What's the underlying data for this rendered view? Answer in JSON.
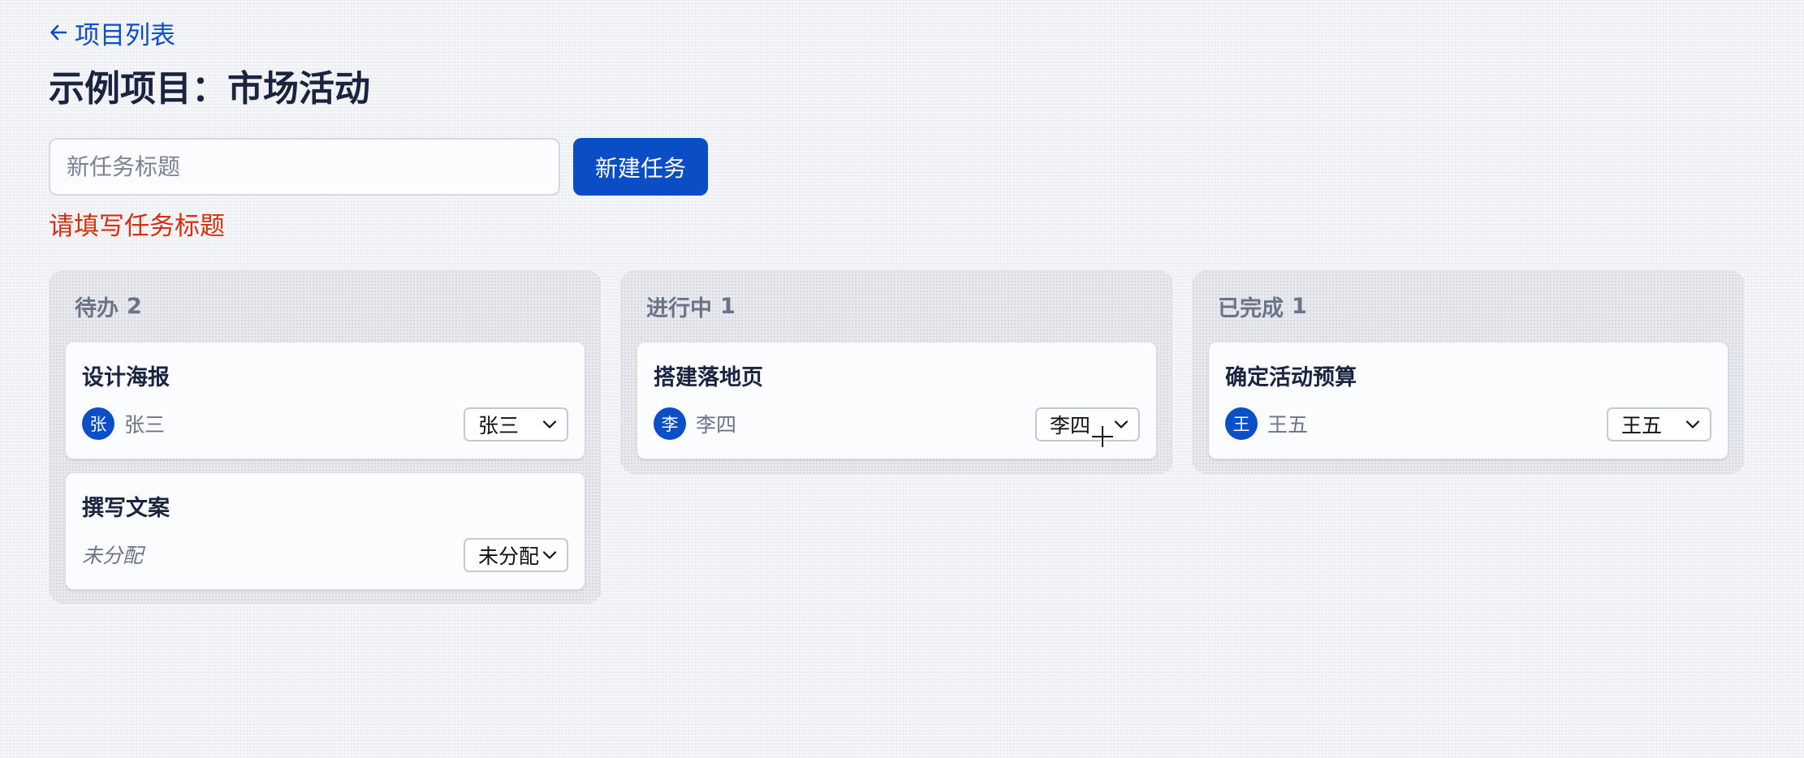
{
  "nav": {
    "back_label": "项目列表"
  },
  "page": {
    "title": "示例项目：市场活动"
  },
  "new_task": {
    "placeholder": "新任务标题",
    "value": "",
    "button_label": "新建任务",
    "error": "请填写任务标题"
  },
  "colors": {
    "accent": "#0a4dc4",
    "error": "#d3300e",
    "column_bg": "#e8e9ee",
    "card_bg": "#fbfcfe"
  },
  "columns": [
    {
      "name": "待办",
      "count": "2",
      "cards": [
        {
          "title": "设计海报",
          "avatar": "张",
          "assignee": "张三",
          "select_value": "张三"
        },
        {
          "title": "撰写文案",
          "unassigned": "未分配",
          "select_value": "未分配"
        }
      ]
    },
    {
      "name": "进行中",
      "count": "1",
      "cards": [
        {
          "title": "搭建落地页",
          "avatar": "李",
          "assignee": "李四",
          "select_value": "李四"
        }
      ]
    },
    {
      "name": "已完成",
      "count": "1",
      "cards": [
        {
          "title": "确定活动预算",
          "avatar": "王",
          "assignee": "王五",
          "select_value": "王五"
        }
      ]
    }
  ],
  "icons": {
    "back": "arrow-left-icon",
    "select": "chevron-down-icon",
    "cursor": "crosshair-cursor-icon"
  }
}
